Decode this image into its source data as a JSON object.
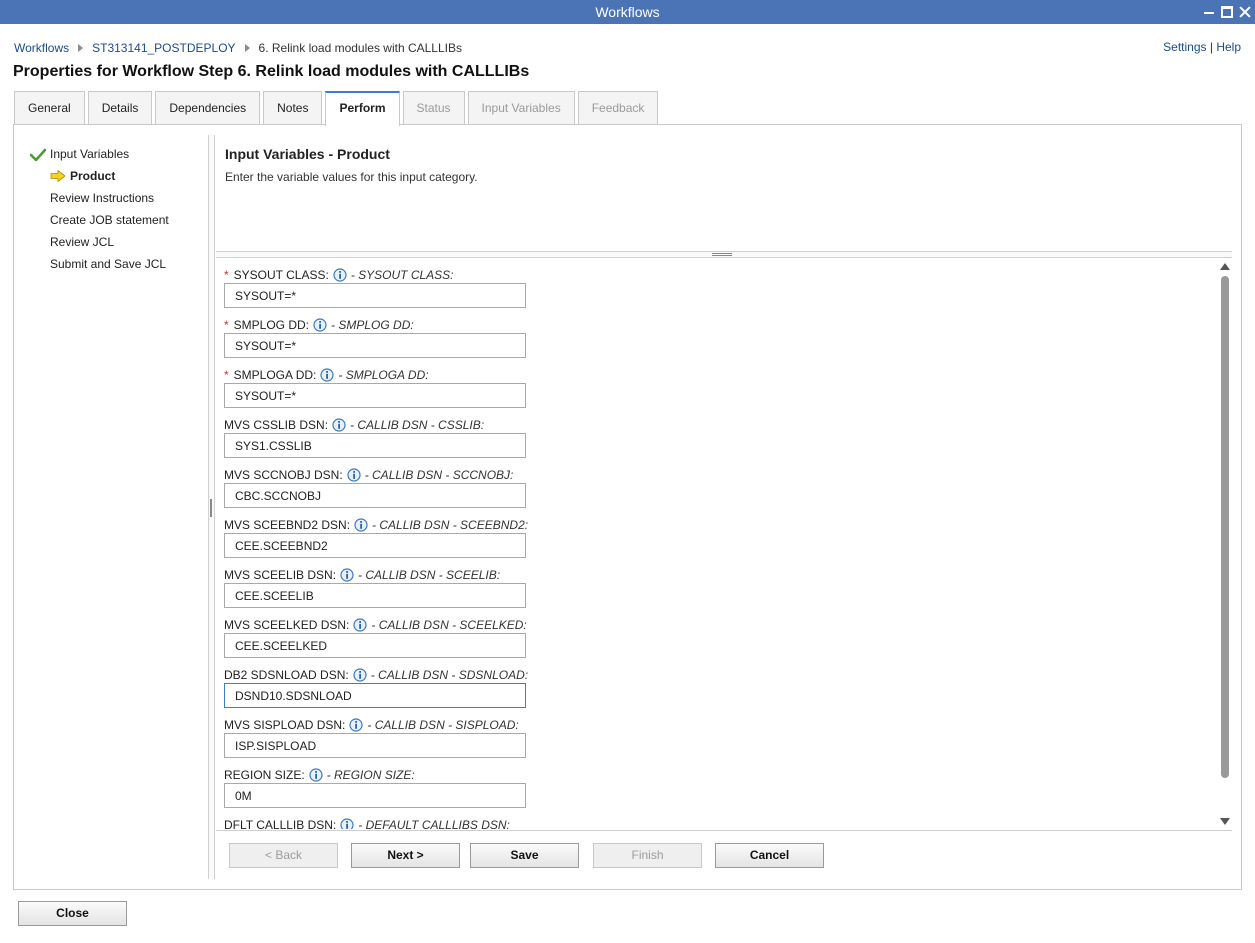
{
  "window": {
    "title": "Workflows"
  },
  "breadcrumb": [
    {
      "label": "Workflows",
      "link": true
    },
    {
      "label": "ST313141_POSTDEPLOY",
      "link": true
    },
    {
      "label": "6. Relink load modules with CALLLIBs",
      "link": false
    }
  ],
  "toplinks": {
    "settings": "Settings",
    "separator": "|",
    "help": "Help"
  },
  "page": {
    "title": "Properties for Workflow Step 6. Relink load modules with CALLLIBs"
  },
  "tabs": [
    {
      "label": "General",
      "state": "normal"
    },
    {
      "label": "Details",
      "state": "normal"
    },
    {
      "label": "Dependencies",
      "state": "normal"
    },
    {
      "label": "Notes",
      "state": "normal"
    },
    {
      "label": "Perform",
      "state": "active"
    },
    {
      "label": "Status",
      "state": "disabled"
    },
    {
      "label": "Input Variables",
      "state": "disabled"
    },
    {
      "label": "Feedback",
      "state": "disabled"
    }
  ],
  "nav": {
    "items": [
      {
        "label": "Input Variables",
        "icon": "check-icon"
      },
      {
        "label": "Product",
        "icon": "arrow-right-icon"
      },
      {
        "label": "Review Instructions"
      },
      {
        "label": "Create JOB statement"
      },
      {
        "label": "Review JCL"
      },
      {
        "label": "Submit and Save JCL"
      }
    ]
  },
  "content": {
    "title": "Input Variables - Product",
    "description": "Enter the variable values for this input category."
  },
  "fields": [
    {
      "required": true,
      "label": "SYSOUT CLASS:",
      "desc": "- SYSOUT CLASS:",
      "value": "SYSOUT=*"
    },
    {
      "required": true,
      "label": "SMPLOG DD:",
      "desc": "- SMPLOG DD:",
      "value": "SYSOUT=*"
    },
    {
      "required": true,
      "label": "SMPLOGA DD:",
      "desc": "- SMPLOGA DD:",
      "value": "SYSOUT=*"
    },
    {
      "required": false,
      "label": "MVS CSSLIB DSN:",
      "desc": "- CALLIB DSN - CSSLIB:",
      "value": "SYS1.CSSLIB"
    },
    {
      "required": false,
      "label": "MVS SCCNOBJ DSN:",
      "desc": "- CALLIB DSN - SCCNOBJ:",
      "value": "CBC.SCCNOBJ"
    },
    {
      "required": false,
      "label": "MVS SCEEBND2 DSN:",
      "desc": "- CALLIB DSN - SCEEBND2:",
      "value": "CEE.SCEEBND2"
    },
    {
      "required": false,
      "label": "MVS SCEELIB DSN:",
      "desc": "- CALLIB DSN - SCEELIB:",
      "value": "CEE.SCEELIB"
    },
    {
      "required": false,
      "label": "MVS SCEELKED DSN:",
      "desc": "- CALLIB DSN - SCEELKED:",
      "value": "CEE.SCEELKED"
    },
    {
      "required": false,
      "label": "DB2 SDSNLOAD DSN:",
      "desc": "- CALLIB DSN - SDSNLOAD:",
      "value": "DSND10.SDSNLOAD",
      "focused": true
    },
    {
      "required": false,
      "label": "MVS SISPLOAD DSN:",
      "desc": "- CALLIB DSN - SISPLOAD:",
      "value": "ISP.SISPLOAD"
    },
    {
      "required": false,
      "label": "REGION SIZE:",
      "desc": "- REGION SIZE:",
      "value": "0M"
    },
    {
      "required": false,
      "label": "DFLT CALLLIB DSN:",
      "desc": "- DEFAULT CALLLIBS DSN:",
      "value": ""
    }
  ],
  "buttons": {
    "back": "< Back",
    "next": "Next >",
    "save": "Save",
    "finish": "Finish",
    "cancel": "Cancel",
    "close": "Close"
  },
  "colors": {
    "titlebar": "#4a74b6",
    "link": "#1a4b8f",
    "required": "#c0392b",
    "active_tab_border": "#3f7fc9"
  }
}
